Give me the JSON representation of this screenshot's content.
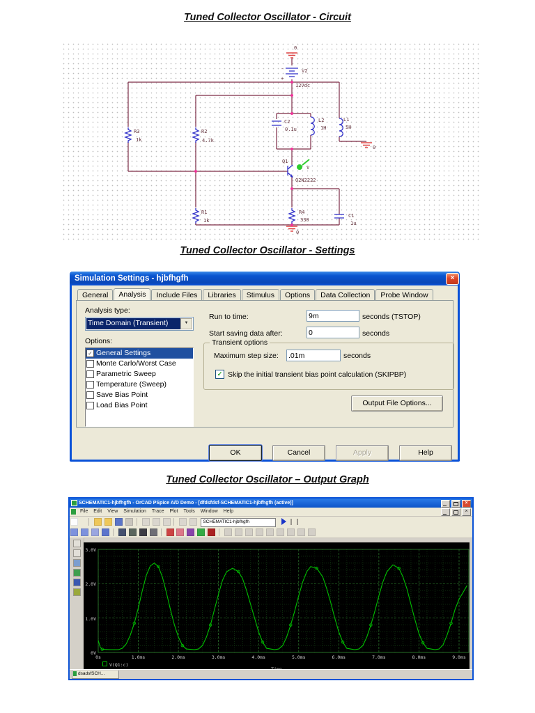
{
  "titles": {
    "circuit": "Tuned Collector Oscillator - Circuit",
    "settings": "Tuned Collector Oscillator - Settings",
    "output": "Tuned Collector Oscillator – Output Graph"
  },
  "circuit": {
    "v2_ref": "V2",
    "v2_value": "12Vdc",
    "minus": "-",
    "plus": "+",
    "r3_ref": "R3",
    "r3_value": "1k",
    "r2_ref": "R2",
    "r2_value": "4.7k",
    "r1_ref": "R1",
    "r1_value": "1k",
    "r4_ref": "R4",
    "r4_value": "330",
    "c2_ref": "C2",
    "c2_value": "0.1u",
    "c1_ref": "C1",
    "c1_value": "1u",
    "l2_ref": "L2",
    "l2_value": "1H",
    "l1_ref": "L1",
    "l1_value": "5H",
    "q1_ref": "Q1",
    "q1_value": "Q2N2222",
    "ground_top": "0",
    "ground_right": "0",
    "ground_bottom": "0",
    "probe_label": "V"
  },
  "dialog": {
    "title": "Simulation Settings - hjbfhgfh",
    "close_glyph": "×",
    "tabs": [
      "General",
      "Analysis",
      "Include Files",
      "Libraries",
      "Stimulus",
      "Options",
      "Data Collection",
      "Probe Window"
    ],
    "active_tab": "Analysis",
    "analysis_type_label": "Analysis type:",
    "analysis_type_value": "Time Domain (Transient)",
    "dropdown_arrow": "▼",
    "options_label": "Options:",
    "check_glyph": "✓",
    "options": [
      {
        "label": "General Settings",
        "checked": true,
        "selected": true
      },
      {
        "label": "Monte Carlo/Worst Case",
        "checked": false
      },
      {
        "label": "Parametric Sweep",
        "checked": false
      },
      {
        "label": "Temperature (Sweep)",
        "checked": false
      },
      {
        "label": "Save Bias Point",
        "checked": false
      },
      {
        "label": "Load Bias Point",
        "checked": false
      }
    ],
    "run_to_time_label": "Run to time:",
    "run_to_time_value": "9m",
    "run_to_time_suffix": "seconds  (TSTOP)",
    "start_saving_label": "Start saving data after:",
    "start_saving_value": "0",
    "start_saving_suffix": "seconds",
    "transient_group_label": "Transient options",
    "max_step_label": "Maximum step size:",
    "max_step_value": ".01m",
    "max_step_suffix": "seconds",
    "skipbp_label": "Skip the initial transient bias point calculation  (SKIPBP)",
    "output_file_button": "Output File Options...",
    "ok": "OK",
    "cancel": "Cancel",
    "apply": "Apply",
    "help": "Help"
  },
  "pspice": {
    "window_title": "SCHEMATIC1-hjbfhgfh - OrCAD PSpice A/D Demo  - [dfdsfdsf-SCHEMATIC1-hjbfhgfh (active)]",
    "menus": [
      "File",
      "Edit",
      "View",
      "Simulation",
      "Trace",
      "Plot",
      "Tools",
      "Window",
      "Help"
    ],
    "schematic_combo": "SCHEMATIC1-hjbfhgfh",
    "bottom_tab": "dsadsfSCH..."
  },
  "chart_data": {
    "type": "line",
    "title": "",
    "xlabel": "Time",
    "ylabel": "",
    "bg_color": "#000000",
    "grid": true,
    "grid_major_color": "#2e7d2e",
    "grid_minor_color": "#143f14",
    "xlim_ms": [
      0,
      9.25
    ],
    "ylim_v": [
      0,
      3
    ],
    "x_tick_labels": [
      "0s",
      "1.0ms",
      "2.0ms",
      "3.0ms",
      "4.0ms",
      "5.0ms",
      "6.0ms",
      "7.0ms",
      "8.0ms",
      "9.0ms"
    ],
    "x_tick_ms": [
      0,
      1,
      2,
      3,
      4,
      5,
      6,
      7,
      8,
      9
    ],
    "y_tick_labels": [
      "0V",
      "1.0V",
      "2.0V",
      "3.0V"
    ],
    "y_tick_v": [
      0,
      1,
      2,
      3
    ],
    "legend_position": "bottom-left",
    "series": [
      {
        "name": "V(Q1:c)",
        "color": "#00c000",
        "x_ms": [
          0,
          0.05,
          0.1,
          0.3,
          0.5,
          0.6,
          0.7,
          0.8,
          0.9,
          1.0,
          1.1,
          1.2,
          1.3,
          1.4,
          1.5,
          1.6,
          1.7,
          1.8,
          1.9,
          2.0,
          2.1,
          2.2,
          2.4,
          2.5,
          2.6,
          2.7,
          2.8,
          2.9,
          3.0,
          3.1,
          3.2,
          3.35,
          3.5,
          3.6,
          3.7,
          3.8,
          3.9,
          4.0,
          4.1,
          4.2,
          4.4,
          4.5,
          4.6,
          4.7,
          4.8,
          4.9,
          5.0,
          5.1,
          5.2,
          5.3,
          5.45,
          5.6,
          5.7,
          5.8,
          5.9,
          6.0,
          6.1,
          6.2,
          6.4,
          6.5,
          6.6,
          6.7,
          6.8,
          6.9,
          7.0,
          7.1,
          7.2,
          7.35,
          7.5,
          7.6,
          7.7,
          7.8,
          7.9,
          8.0,
          8.1,
          8.2,
          8.4,
          8.5,
          8.6,
          8.7,
          8.8,
          8.9,
          9.0,
          9.1,
          9.2
        ],
        "v": [
          0.35,
          0.15,
          0.09,
          0.08,
          0.08,
          0.12,
          0.25,
          0.5,
          0.85,
          1.3,
          1.8,
          2.25,
          2.52,
          2.6,
          2.5,
          2.2,
          1.75,
          1.25,
          0.8,
          0.45,
          0.2,
          0.1,
          0.08,
          0.1,
          0.2,
          0.45,
          0.8,
          1.25,
          1.7,
          2.1,
          2.35,
          2.45,
          2.35,
          2.15,
          1.8,
          1.4,
          1.0,
          0.6,
          0.3,
          0.12,
          0.08,
          0.1,
          0.2,
          0.45,
          0.8,
          1.2,
          1.65,
          2.05,
          2.35,
          2.5,
          2.45,
          2.2,
          1.85,
          1.45,
          1.0,
          0.6,
          0.3,
          0.12,
          0.08,
          0.1,
          0.2,
          0.45,
          0.8,
          1.2,
          1.65,
          2.05,
          2.35,
          2.55,
          2.45,
          2.2,
          1.85,
          1.4,
          0.95,
          0.55,
          0.28,
          0.12,
          0.08,
          0.1,
          0.22,
          0.5,
          0.85,
          1.25,
          1.55,
          1.75,
          1.95
        ]
      }
    ]
  }
}
